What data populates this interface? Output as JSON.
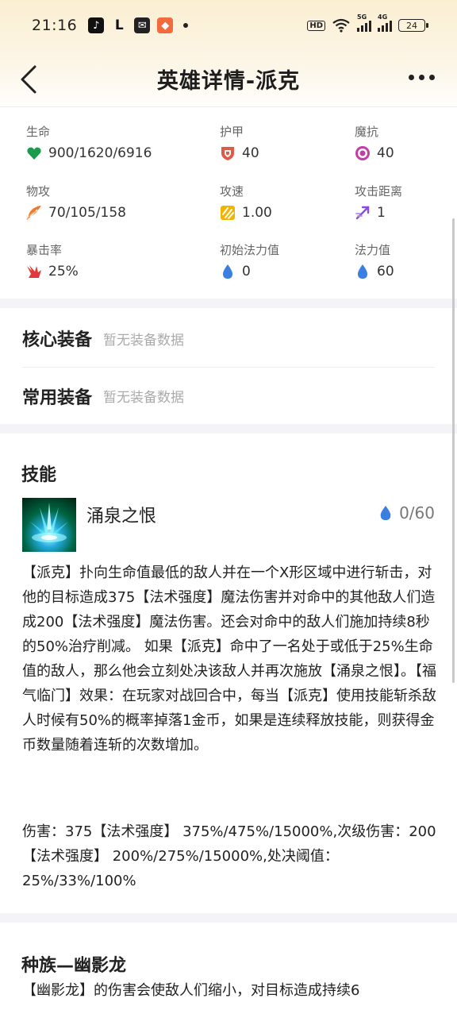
{
  "status_bar": {
    "time": "21:16",
    "battery": "24",
    "network_label": "4G",
    "hd_label": "HD",
    "wifi_label": "5G"
  },
  "header": {
    "title": "英雄详情-派克"
  },
  "stats": [
    {
      "label": "生命",
      "value": "900/1620/6916",
      "icon": "health-icon",
      "color": "#1c9a4d"
    },
    {
      "label": "护甲",
      "value": "40",
      "icon": "armor-icon",
      "color": "#e05a4a"
    },
    {
      "label": "魔抗",
      "value": "40",
      "icon": "magic-resist-icon",
      "color": "#c23fa8"
    },
    {
      "label": "物攻",
      "value": "70/105/158",
      "icon": "attack-damage-icon",
      "color": "#f07a2a"
    },
    {
      "label": "攻速",
      "value": "1.00",
      "icon": "attack-speed-icon",
      "color": "#f2b400"
    },
    {
      "label": "攻击距离",
      "value": "1",
      "icon": "attack-range-icon",
      "color": "#8a4be0"
    },
    {
      "label": "暴击率",
      "value": "25%",
      "icon": "crit-icon",
      "color": "#e23a3a"
    },
    {
      "label": "初始法力值",
      "value": "0",
      "icon": "mana-drop-icon",
      "color": "#3b7fe0"
    },
    {
      "label": "法力值",
      "value": "60",
      "icon": "mana-drop-icon",
      "color": "#3b7fe0"
    }
  ],
  "equipment": {
    "core_title": "核心装备",
    "core_empty": "暂无装备数据",
    "common_title": "常用装备",
    "common_empty": "暂无装备数据"
  },
  "skill": {
    "section_title": "技能",
    "name": "涌泉之恨",
    "cost": "0/60",
    "description": "【派克】扑向生命值最低的敌人并在一个X形区域中进行斩击，对他的目标造成375【法术强度】魔法伤害并对命中的其他敌人们造成200【法术强度】魔法伤害。还会对命中的敌人们施加持续8秒的50%治疗削减。 如果【派克】命中了一名处于或低于25%生命值的敌人，那么他会立刻处决该敌人并再次施放【涌泉之恨】。【福气临门】效果：在玩家对战回合中，每当【派克】使用技能斩杀敌人时候有50%的概率掉落1金币，如果是连续释放技能，则获得金币数量随着连斩的次数增加。",
    "damage": "伤害：375【法术强度】 375%/475%/15000%,次级伤害：200【法术强度】 200%/275%/15000%,处决阈值： 25%/33%/100%"
  },
  "race": {
    "title": "种族—幽影龙",
    "description": "【幽影龙】的伤害会使敌人们缩小，对目标造成持续6"
  }
}
